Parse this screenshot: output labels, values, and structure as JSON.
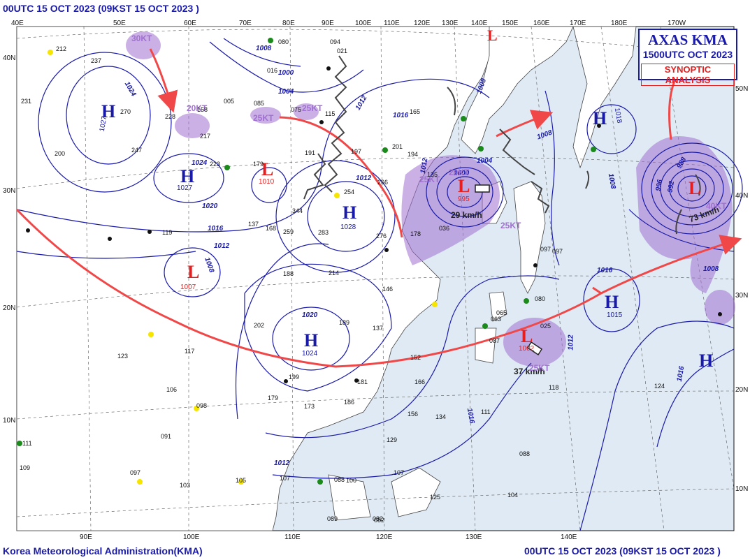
{
  "header": {
    "top_left": "00UTC 15 OCT 2023 (09KST 15 OCT 2023 )",
    "bottom_left": "Korea Meteorological Administration(KMA)",
    "bottom_right": "00UTC 15 OCT 2023 (09KST 15 OCT 2023 )"
  },
  "title_box": {
    "line1": "AXAS KMA",
    "line2": "1500UTC OCT 2023",
    "line3": "SYNOPTIC ANALYSIS"
  },
  "axes": {
    "top_longitudes": [
      "40E",
      "50E",
      "60E",
      "70E",
      "80E",
      "90E",
      "100E",
      "110E",
      "120E",
      "130E",
      "140E",
      "150E",
      "160E",
      "170E",
      "180E",
      "170W"
    ],
    "bottom_longitudes": [
      "90E",
      "100E",
      "110E",
      "120E",
      "130E",
      "140E"
    ],
    "left_latitudes": [
      "40N",
      "30N",
      "20N",
      "10N"
    ],
    "right_latitudes": [
      "50N",
      "40N",
      "30N",
      "20N",
      "10N"
    ]
  },
  "systems": {
    "highs": [
      {
        "label": "H",
        "pressure": "1027"
      },
      {
        "label": "H",
        "pressure": "1027"
      },
      {
        "label": "H",
        "pressure": "1028"
      },
      {
        "label": "H",
        "pressure": "1024"
      },
      {
        "label": "H",
        "pressure": "1015"
      },
      {
        "label": "H",
        "pressure": "1018"
      },
      {
        "label": "H",
        "pressure": ""
      }
    ],
    "lows": [
      {
        "label": "L",
        "pressure": "1007"
      },
      {
        "label": "L",
        "pressure": "1010"
      },
      {
        "label": "L",
        "pressure": "995"
      },
      {
        "label": "L",
        "pressure": "1002"
      },
      {
        "label": "L",
        "pressure": ""
      }
    ]
  },
  "isobar_labels": [
    "1024",
    "1008",
    "1004",
    "1000",
    "1012",
    "1024",
    "1020",
    "1016",
    "1012",
    "1008",
    "1016",
    "1008",
    "1012",
    "1016",
    "1008",
    "1012",
    "1012",
    "1016",
    "1020",
    "1012",
    "1008",
    "1004",
    "1000",
    "996",
    "992",
    "988",
    "1008",
    "1016"
  ],
  "annotations": {
    "speed_black": [
      "29 km/h",
      "37 km/h",
      "73 km/h"
    ],
    "kt_purple": [
      "30KT",
      "25KT",
      "25KT",
      "25KT",
      "25KT",
      "20KT",
      "20KT",
      "40KT",
      "25KT"
    ]
  },
  "station_numbers": [
    "212",
    "237",
    "231",
    "200",
    "270",
    "228",
    "247",
    "158",
    "217",
    "085",
    "094",
    "080",
    "016",
    "021",
    "075",
    "115",
    "165",
    "197",
    "201",
    "194",
    "191",
    "179",
    "223",
    "344",
    "254",
    "266",
    "283",
    "259",
    "276",
    "178",
    "036",
    "135",
    "005",
    "119",
    "137",
    "168",
    "188",
    "214",
    "202",
    "189",
    "146",
    "137",
    "199",
    "173",
    "179",
    "181",
    "186",
    "152",
    "166",
    "156",
    "129",
    "134",
    "118",
    "124",
    "111",
    "107",
    "125",
    "082",
    "089",
    "088",
    "104",
    "097",
    "080",
    "087",
    "063",
    "065",
    "097",
    "025",
    "098",
    "106",
    "117",
    "123",
    "091",
    "097",
    "105",
    "103",
    "107",
    "088",
    "100",
    "082",
    "111",
    "109"
  ],
  "colors": {
    "isobar": "#1a1aa8",
    "front": "#f04848",
    "system_high": "#1a1aa8",
    "system_low": "#e81e1e",
    "rain_area": "#a070d0",
    "sea": "#dfeaf4",
    "land": "#ffffff"
  }
}
